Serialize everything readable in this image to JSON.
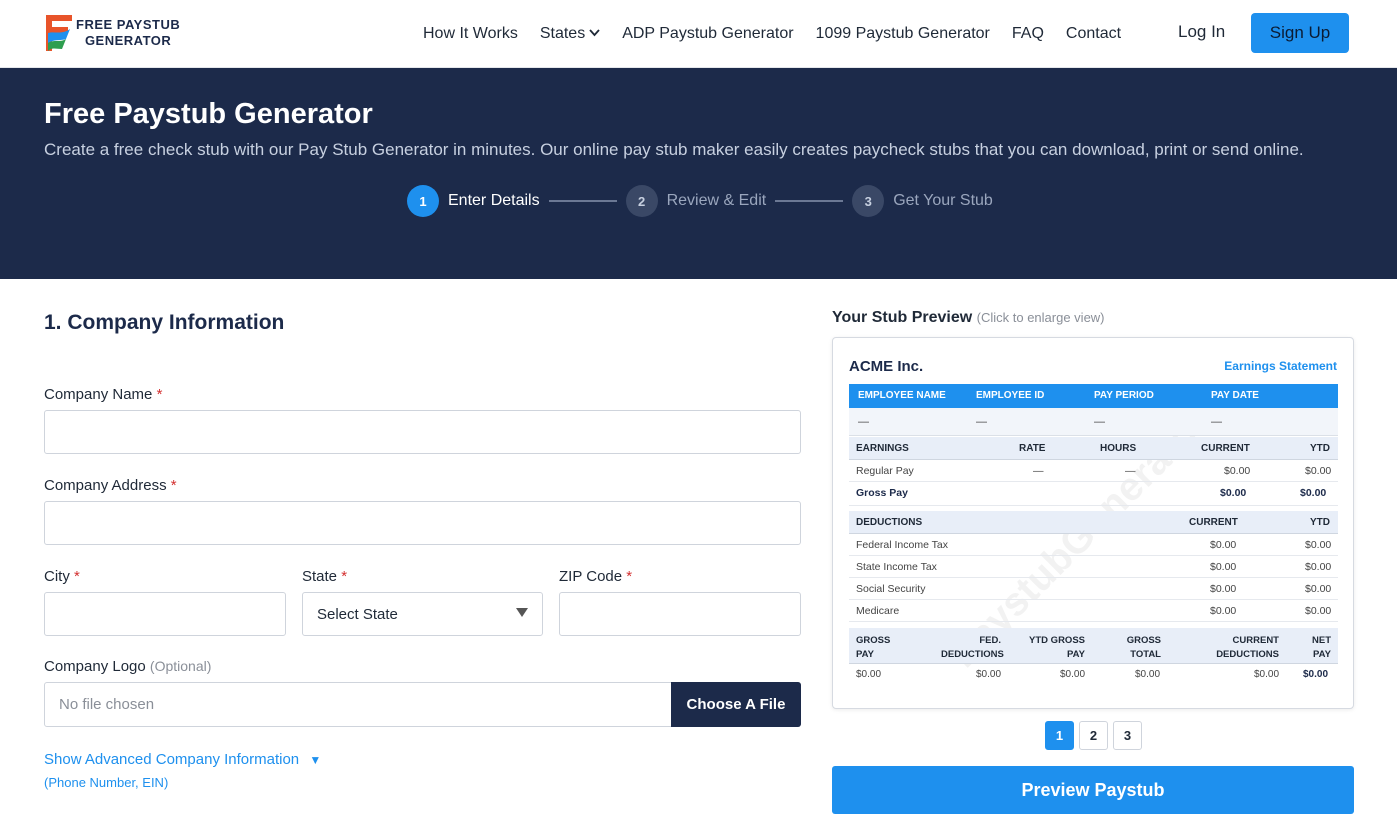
{
  "brand": {
    "line1": "FREE PAYSTUB",
    "line2": "GENERATOR",
    "colors": {
      "accent": "#1e90ee",
      "navy": "#1c2a4a"
    }
  },
  "nav": {
    "items": [
      "How It Works",
      "States",
      "ADP Paystub Generator",
      "1099 Paystub Generator",
      "FAQ",
      "Contact"
    ],
    "login": "Log In",
    "signup": "Sign Up"
  },
  "hero": {
    "title": "Free Paystub Generator",
    "subtitle": "Create a free check stub with our Pay Stub Generator in minutes. Our online pay stub maker easily creates paycheck stubs that you can download, print or send online.",
    "steps": [
      {
        "num": "1",
        "label": "Enter Details"
      },
      {
        "num": "2",
        "label": "Review & Edit"
      },
      {
        "num": "3",
        "label": "Get Your Stub"
      }
    ]
  },
  "form": {
    "section_title": "1. Company Information",
    "company_name_label": "Company Name",
    "company_address_label": "Company Address",
    "city_label": "City",
    "state_label": "State",
    "state_value": "Select State",
    "zip_label": "ZIP Code",
    "logo_label": "Company Logo",
    "logo_optional": "(Optional)",
    "file_placeholder": "No file chosen",
    "choose_file": "Choose A File",
    "required_mark": "*",
    "advanced_link": "Show Advanced Company Information",
    "advanced_arrow": "▼",
    "advanced_sub": "(Phone Number, EIN)"
  },
  "preview": {
    "title": "Your Stub Preview",
    "hint": "(Click to enlarge view)",
    "company": "ACME Inc.",
    "statement": "Earnings Statement",
    "watermark": "PaystubGenerators",
    "employee_headers": [
      "EMPLOYEE NAME",
      "EMPLOYEE ID",
      "PAY PERIOD",
      "PAY DATE"
    ],
    "employee_values": [
      "—",
      "—",
      "—",
      "—"
    ],
    "earnings_headers": [
      "EARNINGS",
      "RATE",
      "HOURS",
      "CURRENT",
      "YTD"
    ],
    "earnings_rows": [
      {
        "name": "Regular Pay",
        "rate": "—",
        "hours": "—",
        "current": "$0.00",
        "ytd": "$0.00"
      },
      {
        "name": "Gross Pay",
        "rate": "",
        "hours": "",
        "current": "$0.00",
        "ytd": "$0.00"
      }
    ],
    "deductions_headers": [
      "DEDUCTIONS",
      "CURRENT",
      "YTD"
    ],
    "deductions_rows": [
      {
        "name": "Federal Income Tax",
        "current": "$0.00",
        "ytd": "$0.00"
      },
      {
        "name": "State Income Tax",
        "current": "$0.00",
        "ytd": "$0.00"
      },
      {
        "name": "Social Security",
        "current": "$0.00",
        "ytd": "$0.00"
      },
      {
        "name": "Medicare",
        "current": "$0.00",
        "ytd": "$0.00"
      }
    ],
    "summary_headers": [
      [
        "GROSS",
        "PAY"
      ],
      [
        "FED.",
        "DEDUCTIONS"
      ],
      [
        "YTD GROSS",
        "PAY"
      ],
      [
        "GROSS",
        "TOTAL"
      ],
      [
        "CURRENT",
        "DEDUCTIONS"
      ],
      [
        "NET",
        "PAY"
      ]
    ],
    "summary_values": [
      "$0.00",
      "$0.00",
      "$0.00",
      "$0.00",
      "$0.00",
      "$0.00"
    ],
    "pages": [
      "1",
      "2",
      "3"
    ],
    "button": "Preview Paystub"
  }
}
